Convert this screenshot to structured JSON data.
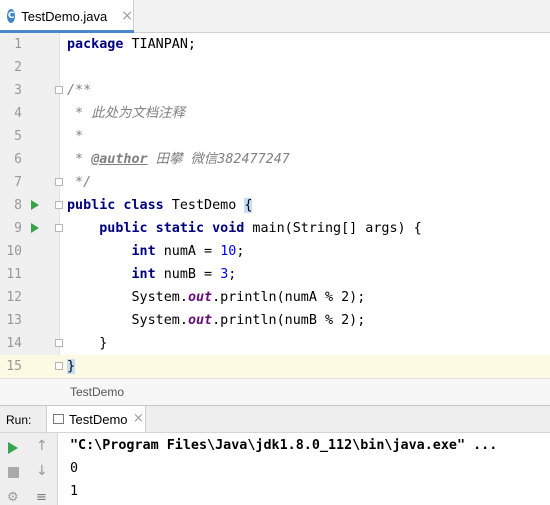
{
  "editor_tab": {
    "label": "TestDemo.java",
    "icon": "java-class-icon",
    "icon_letter": "C",
    "close": "×"
  },
  "code_lines": [
    {
      "n": "1"
    },
    {
      "n": "2"
    },
    {
      "n": "3"
    },
    {
      "n": "4"
    },
    {
      "n": "5"
    },
    {
      "n": "6"
    },
    {
      "n": "7"
    },
    {
      "n": "8"
    },
    {
      "n": "9"
    },
    {
      "n": "10"
    },
    {
      "n": "11"
    },
    {
      "n": "12"
    },
    {
      "n": "13"
    },
    {
      "n": "14"
    },
    {
      "n": "15"
    }
  ],
  "code": {
    "l1_kw": "package",
    "l1_rest": " TIANPAN;",
    "l3": "/**",
    "l4": " * 此处为文档注释",
    "l5": " *",
    "l6_pre": " * ",
    "l6_tag": "@author",
    "l6_rest": " 田攀 微信382477247",
    "l7": " */",
    "l8_kw": "public class",
    "l8_name": " TestDemo ",
    "l8_brace": "{",
    "l9_indent": "    ",
    "l9_kw": "public static void",
    "l9_rest": " main(String[] args) {",
    "l10_indent": "        ",
    "l10_kw": "int",
    "l10_mid": " numA = ",
    "l10_num": "10",
    "l10_end": ";",
    "l11_indent": "        ",
    "l11_kw": "int",
    "l11_mid": " numB = ",
    "l11_num": "3",
    "l11_end": ";",
    "l12_pre": "        System.",
    "l12_field": "out",
    "l12_rest": ".println(numA % 2);",
    "l13_pre": "        System.",
    "l13_field": "out",
    "l13_rest": ".println(numB % 2);",
    "l14": "    }",
    "l15_brace": "}"
  },
  "breadcrumb": "TestDemo",
  "run_panel": {
    "label": "Run:",
    "tab_label": "TestDemo",
    "tab_close": "×",
    "command": "\"C:\\Program Files\\Java\\jdk1.8.0_112\\bin\\java.exe\" ...",
    "output": [
      "0",
      "1"
    ]
  },
  "colors": {
    "keyword": "#000080",
    "number": "#0000ff",
    "comment": "#808080",
    "string": "#008000",
    "accent": "#4a88c7",
    "run_green": "#3aa34a"
  }
}
